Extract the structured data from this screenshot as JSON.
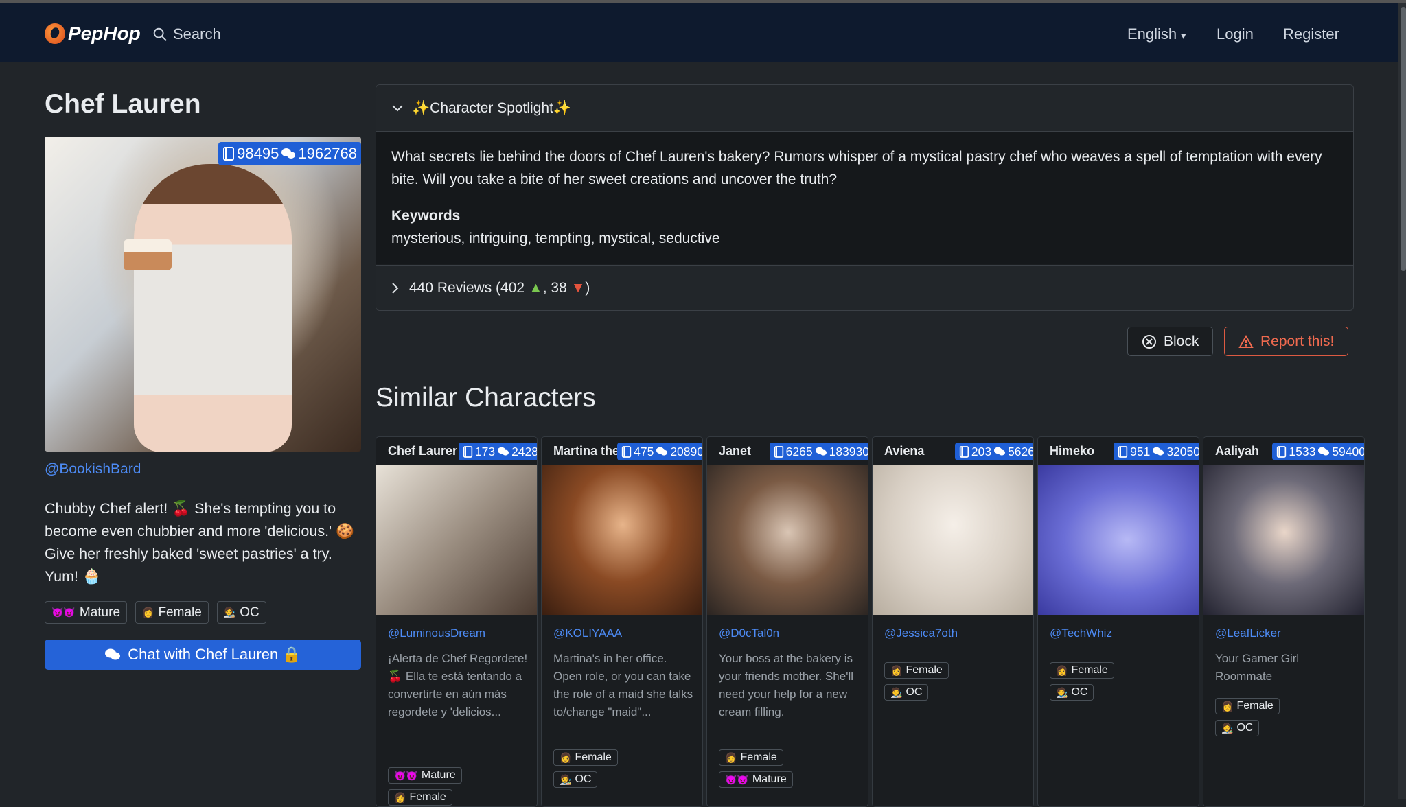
{
  "nav": {
    "brand": "PepHop",
    "search_label": "Search",
    "language": "English",
    "login": "Login",
    "register": "Register"
  },
  "character": {
    "name": "Chef Lauren",
    "stats": {
      "messages": "98495",
      "chats": "1962768"
    },
    "author": "@BookishBard",
    "description": "Chubby Chef alert! 🍒 She's tempting you to become even chubbier and more 'delicious.' 🍪 Give her freshly baked 'sweet pastries' a try. Yum! 🧁",
    "tags": [
      {
        "emoji": "😈😈",
        "label": "Mature"
      },
      {
        "emoji": "👩",
        "label": "Female"
      },
      {
        "emoji": "🧑‍🎨",
        "label": "OC"
      }
    ],
    "chat_button": "Chat with Chef Lauren 🔒"
  },
  "spotlight": {
    "header": "✨Character Spotlight✨",
    "body": "What secrets lie behind the doors of Chef Lauren's bakery? Rumors whisper of a mystical pastry chef who weaves a spell of temptation with every bite. Will you take a bite of her sweet creations and uncover the truth?",
    "keywords_label": "Keywords",
    "keywords": "mysterious, intriguing, tempting, mystical, seductive",
    "reviews_a": "440 Reviews (402",
    "reviews_b": ", 38",
    "reviews_c": ")"
  },
  "actions": {
    "block": "Block",
    "report": "Report this!"
  },
  "similar": {
    "title": "Similar Characters",
    "cards": [
      {
        "name": "Chef Lauren",
        "messages": "173",
        "chats": "2428",
        "author": "@LuminousDream",
        "desc": "¡Alerta de Chef Regordete! 🍒 Ella te está tentando a convertirte en aún más regordete y 'delicios...",
        "tags": [
          {
            "emoji": "😈😈",
            "label": "Mature"
          },
          {
            "emoji": "👩",
            "label": "Female"
          }
        ]
      },
      {
        "name": "Martina the Maid",
        "messages": "475",
        "chats": "20890",
        "author": "@KOLIYAAA",
        "desc": "Martina's in her office. Open role, or you can take the role of a maid she talks to/change \"maid\"...",
        "tags": [
          {
            "emoji": "👩",
            "label": "Female"
          },
          {
            "emoji": "🧑‍🎨",
            "label": "OC"
          }
        ]
      },
      {
        "name": "Janet",
        "messages": "6265",
        "chats": "183930",
        "author": "@D0cTal0n",
        "desc": "Your boss at the bakery is your friends mother. She'll need your help for a new cream filling.",
        "tags": [
          {
            "emoji": "👩",
            "label": "Female"
          },
          {
            "emoji": "😈😈",
            "label": "Mature"
          }
        ]
      },
      {
        "name": "Aviena",
        "messages": "203",
        "chats": "5626",
        "author": "@Jessica7oth",
        "desc": "",
        "tags": [
          {
            "emoji": "👩",
            "label": "Female"
          },
          {
            "emoji": "🧑‍🎨",
            "label": "OC"
          }
        ]
      },
      {
        "name": "Himeko",
        "messages": "951",
        "chats": "32050",
        "author": "@TechWhiz",
        "desc": "",
        "tags": [
          {
            "emoji": "👩",
            "label": "Female"
          },
          {
            "emoji": "🧑‍🎨",
            "label": "OC"
          }
        ]
      },
      {
        "name": "Aaliyah",
        "messages": "1533",
        "chats": "59400",
        "author": "@LeafLicker",
        "desc": "Your Gamer Girl Roommate",
        "tags": [
          {
            "emoji": "👩",
            "label": "Female"
          },
          {
            "emoji": "🧑‍🎨",
            "label": "OC"
          }
        ]
      }
    ]
  },
  "colors": {
    "accent": "#2563d8",
    "nav_bg": "#0e1a2e",
    "page_bg": "#212529",
    "link": "#4d8bf5",
    "report": "#ef6a4f"
  }
}
